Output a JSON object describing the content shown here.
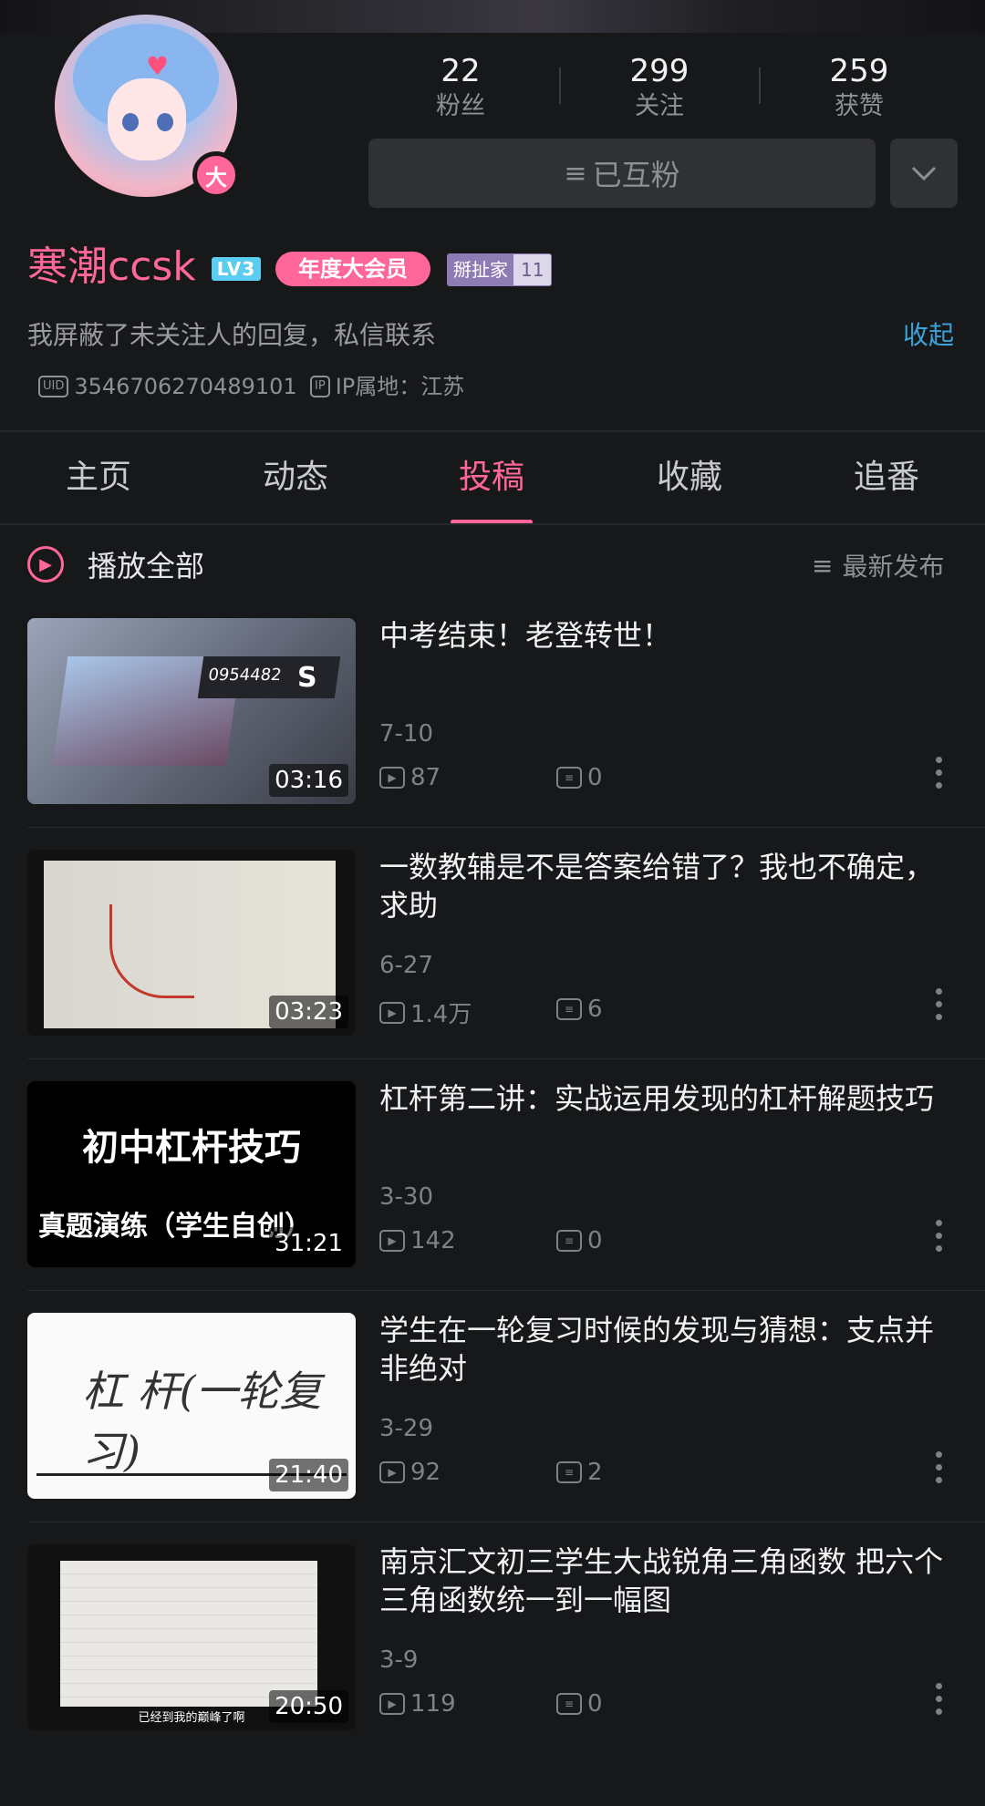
{
  "profile": {
    "username": "寒潮ccsk",
    "level_badge": "LV3",
    "vip_badge": "年度大会员",
    "fan_badge_label": "掰扯家",
    "fan_badge_num": "11",
    "avatar_badge": "大",
    "bio": "我屏蔽了未关注人的回复，私信联系",
    "collapse_label": "收起",
    "uid_tag": "UID",
    "uid": "3546706270489101",
    "ip_tag": "IP",
    "ip_location": "IP属地：江苏"
  },
  "stats": [
    {
      "num": "22",
      "label": "粉丝"
    },
    {
      "num": "299",
      "label": "关注"
    },
    {
      "num": "259",
      "label": "获赞"
    }
  ],
  "follow_button": "已互粉",
  "tabs": [
    {
      "label": "主页",
      "active": false
    },
    {
      "label": "动态",
      "active": false
    },
    {
      "label": "投稿",
      "active": true
    },
    {
      "label": "收藏",
      "active": false
    },
    {
      "label": "追番",
      "active": false
    }
  ],
  "list_header": {
    "play_all": "播放全部",
    "sort_label": "最新发布"
  },
  "videos": [
    {
      "title": "中考结束！老登转世！",
      "date": "7-10",
      "views": "87",
      "comments": "0",
      "duration": "03:16",
      "thumb_text": {
        "score": "0954482",
        "rank": "S"
      }
    },
    {
      "title": "一数教辅是不是答案给错了？我也不确定，求助",
      "date": "6-27",
      "views": "1.4万",
      "comments": "6",
      "duration": "03:23"
    },
    {
      "title": "杠杆第二讲：实战运用发现的杠杆解题技巧",
      "date": "3-30",
      "views": "142",
      "comments": "0",
      "duration": "31:21",
      "thumb_text": {
        "big": "初中杠杆技巧",
        "small": "真题演练（学生自创）"
      }
    },
    {
      "title": "学生在一轮复习时候的发现与猜想：支点并非绝对",
      "date": "3-29",
      "views": "92",
      "comments": "2",
      "duration": "21:40",
      "thumb_text": {
        "hand": "杠 杆(一轮复习)"
      }
    },
    {
      "title": "南京汇文初三学生大战锐角三角函数 把六个三角函数统一到一幅图",
      "date": "3-9",
      "views": "119",
      "comments": "0",
      "duration": "20:50",
      "thumb_text": {
        "caption": "已经到我的巅峰了啊"
      }
    }
  ],
  "colors": {
    "accent": "#FF6699",
    "link": "#3AA3D9",
    "background": "#17181A"
  }
}
